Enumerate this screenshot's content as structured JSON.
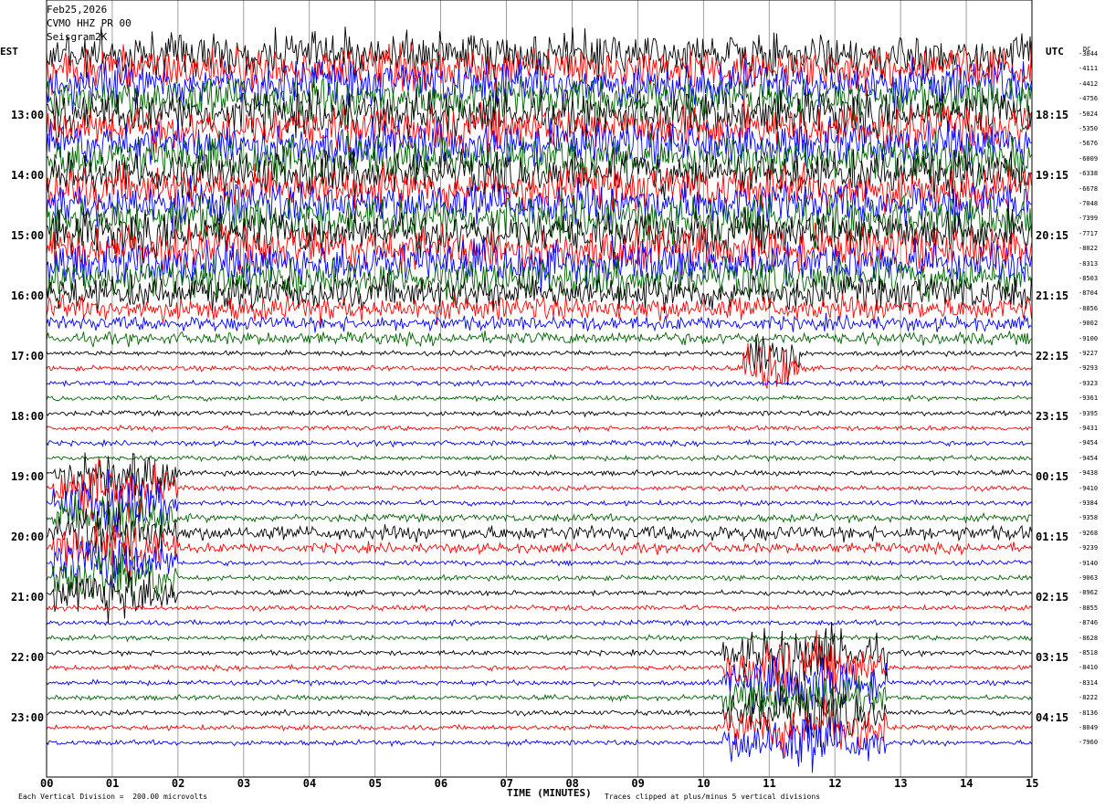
{
  "header": {
    "date": "Feb25,2026",
    "station": "CVMO HHZ PR 00",
    "source": "Seisgram2K"
  },
  "left_timezone": "EST",
  "right_timezone": "UTC",
  "dc_header": "DC",
  "footer": {
    "scale_note": "Each Vertical Division =  200.00 microvolts",
    "xaxis_label": "TIME (MINUTES)",
    "clip_note": "Traces clipped at plus/minus 5 vertical divisions"
  },
  "chart_data": {
    "type": "line",
    "title": "",
    "xlabel": "TIME (MINUTES)",
    "xlim": [
      0,
      15
    ],
    "x_ticks": [
      "00",
      "01",
      "02",
      "03",
      "04",
      "05",
      "06",
      "07",
      "08",
      "09",
      "10",
      "11",
      "12",
      "13",
      "14",
      "15"
    ],
    "trace_minutes": 15,
    "trace_colors": [
      "#000000",
      "#ff0000",
      "#0000ff",
      "#006400"
    ],
    "hour_labels_left": [
      "13:00",
      "14:00",
      "15:00",
      "16:00",
      "17:00",
      "18:00",
      "19:00",
      "20:00",
      "21:00",
      "22:00",
      "23:00"
    ],
    "hour_labels_right": [
      "18:15",
      "19:15",
      "20:15",
      "21:15",
      "22:15",
      "23:15",
      "00:15",
      "01:15",
      "02:15",
      "03:15",
      "04:15"
    ],
    "dc_offsets": [
      -3844,
      -4111,
      -4412,
      -4756,
      -5024,
      -5350,
      -5676,
      -6009,
      -6338,
      -6678,
      -7048,
      -7399,
      -7717,
      -8022,
      -8313,
      -8503,
      -8704,
      -8856,
      -9002,
      -9100,
      -9227,
      -9293,
      -9323,
      -9361,
      -9395,
      -9431,
      -9454,
      -9454,
      -9438,
      -9410,
      -9384,
      -9358,
      -9268,
      -9239,
      -9140,
      -9063,
      -8962,
      -8855,
      -8746,
      -8628,
      -8518,
      -8410,
      -8314,
      -8222,
      -8136,
      -8049,
      -7960
    ],
    "trace_activity": [
      9,
      9,
      9,
      9,
      9,
      9,
      9,
      9,
      9,
      9,
      9,
      9,
      9,
      9,
      9,
      8,
      7,
      5,
      3,
      2.5,
      1,
      1,
      1,
      1,
      1,
      1,
      1,
      1,
      1,
      1,
      1,
      1.5,
      3,
      2,
      1,
      1,
      1,
      1,
      1,
      1,
      1,
      1,
      1,
      1,
      1,
      1,
      1
    ],
    "events": [
      {
        "start_trace": 28,
        "end_trace": 36,
        "start_min": 0.1,
        "end_min": 2.0,
        "note": "burst"
      },
      {
        "start_trace": 20,
        "end_trace": 21,
        "start_min": 10.6,
        "end_min": 11.5,
        "note": "local event"
      },
      {
        "start_trace": 40,
        "end_trace": 46,
        "start_min": 10.3,
        "end_min": 12.8,
        "note": "regional event"
      }
    ]
  }
}
